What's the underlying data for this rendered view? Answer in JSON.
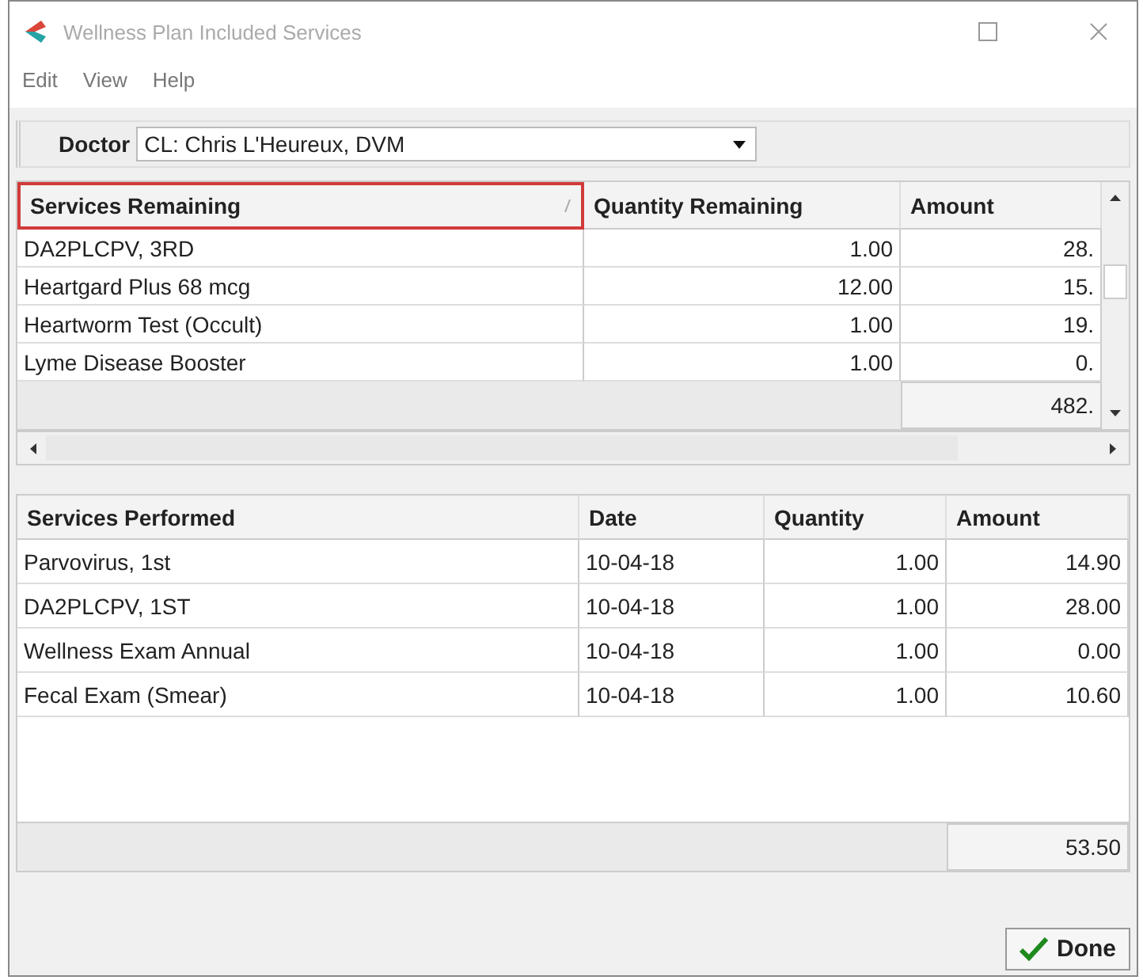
{
  "window": {
    "title": "Wellness Plan Included Services"
  },
  "menu": [
    "Edit",
    "View",
    "Help"
  ],
  "doctor": {
    "label": "Doctor",
    "value": "CL: Chris L'Heureux, DVM"
  },
  "remaining": {
    "columns": [
      {
        "label": "Services Remaining",
        "highlighted": true
      },
      {
        "label": "Quantity Remaining",
        "highlighted": false
      },
      {
        "label": "Amount",
        "highlighted": false
      }
    ],
    "rows": [
      [
        "DA2PLCPV, 3RD",
        "1.00",
        "28."
      ],
      [
        "Heartgard Plus 68 mcg",
        "12.00",
        "15."
      ],
      [
        "Heartworm Test (Occult)",
        "1.00",
        "19."
      ],
      [
        "Lyme Disease Booster",
        "1.00",
        "0."
      ]
    ],
    "total": "482."
  },
  "performed": {
    "columns": [
      "Services Performed",
      "Date",
      "Quantity",
      "Amount"
    ],
    "rows": [
      [
        "Parvovirus, 1st",
        "10-04-18",
        "1.00",
        "14.90"
      ],
      [
        "DA2PLCPV, 1ST",
        "10-04-18",
        "1.00",
        "28.00"
      ],
      [
        "Wellness Exam Annual",
        "10-04-18",
        "1.00",
        "0.00"
      ],
      [
        "Fecal Exam (Smear)",
        "10-04-18",
        "1.00",
        "10.60"
      ]
    ],
    "total": "53.50"
  },
  "done_button": "Done"
}
